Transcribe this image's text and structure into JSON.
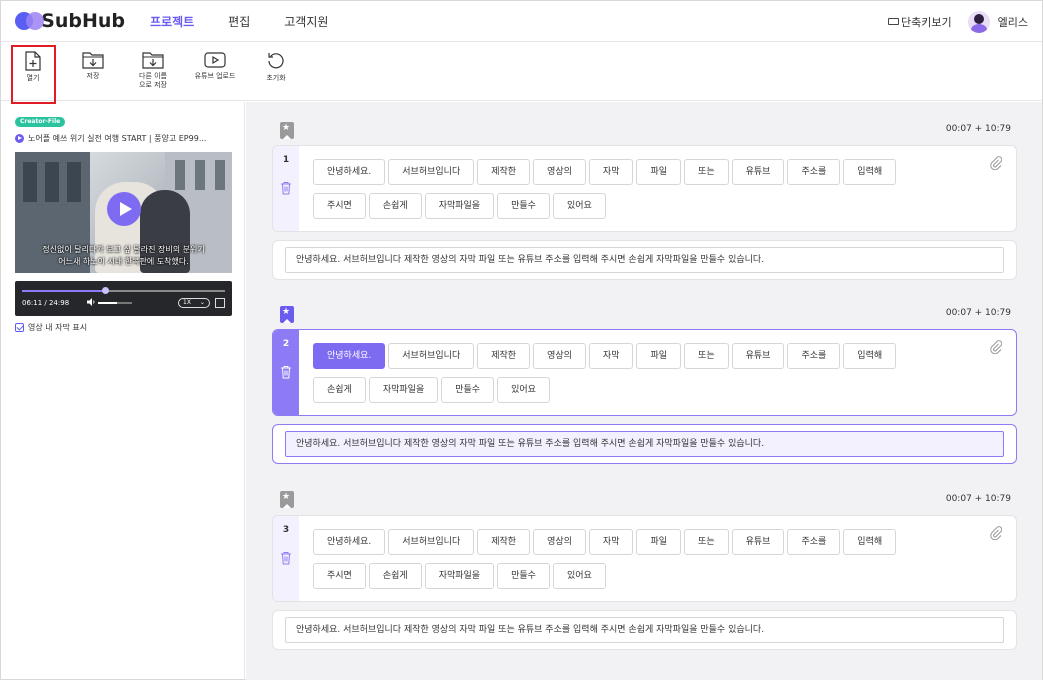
{
  "app": {
    "logo": "SubHub"
  },
  "nav": {
    "items": [
      {
        "label": "프로젝트",
        "active": true
      },
      {
        "label": "편집",
        "active": false
      },
      {
        "label": "고객지원",
        "active": false
      }
    ]
  },
  "header": {
    "shortcut": "단축키보기",
    "user": "엘리스"
  },
  "toolbar": {
    "open": "열기",
    "save": "저장",
    "save_as_1": "다른 이름",
    "save_as_2": "으로 저장",
    "youtube": "유튜브 업로드",
    "reset": "초기화"
  },
  "video": {
    "badge": "Creator-File",
    "title": "노어플 예쓰 위기 실전 여행 START | 풍양고 EP99...",
    "subtitle_1": "정신없이 달리다가 보고 싶 달라진 장비의 분위기",
    "subtitle_2": "어느새 하노이 시내 한복판에 도착했다.",
    "time": "06:11 / 24:98",
    "progress": 0.41,
    "volume": 0.55,
    "speed": "1X",
    "show_subs_label": "영상 내 자막 표시"
  },
  "segments": [
    {
      "number": "1",
      "time": "00:07 + 10:79",
      "active": false,
      "selected_chip": -1,
      "chips": [
        "안녕하세요.",
        "서브허브입니다",
        "제작한",
        "영상의",
        "자막",
        "파일",
        "또는",
        "유튜브",
        "주소를",
        "입력해",
        "주시면",
        "손쉽게",
        "자막파일을",
        "만들수",
        "있어요"
      ],
      "text": "안녕하세요. 서브허브입니다 제작한 영상의 자막 파일 또는 유튜브 주소를 입력해 주시면 손쉽게 자막파일을 만들수 있습니다."
    },
    {
      "number": "2",
      "time": "00:07 + 10:79",
      "active": true,
      "selected_chip": 0,
      "chips": [
        "안녕하세요.",
        "서브허브입니다",
        "제작한",
        "영상의",
        "자막",
        "파일",
        "또는",
        "유튜브",
        "주소를",
        "입력해",
        "손쉽게",
        "자막파일을",
        "만들수",
        "있어요"
      ],
      "text": "안녕하세요. 서브허브입니다 제작한 영상의 자막 파일 또는 유튜브 주소를 입력해 주시면 손쉽게 자막파일을 만들수 있습니다."
    },
    {
      "number": "3",
      "time": "00:07 + 10:79",
      "active": false,
      "selected_chip": -1,
      "chips": [
        "안녕하세요.",
        "서브허브입니다",
        "제작한",
        "영상의",
        "자막",
        "파일",
        "또는",
        "유튜브",
        "주소를",
        "입력해",
        "주시면",
        "손쉽게",
        "자막파일을",
        "만들수",
        "있어요"
      ],
      "text": "안녕하세요. 서브허브입니다 제작한 영상의 자막 파일 또는 유튜브 주소를 입력해 주시면 손쉽게 자막파일을 만들수 있습니다."
    }
  ],
  "colors": {
    "accent": "#6b5cf0",
    "chip_selected": "#7d6cf2",
    "highlight": "#e01d25",
    "badge": "#2bc29f"
  },
  "icons": [
    "logo-icon",
    "keyboard-icon",
    "avatar",
    "file-add-icon",
    "folder-download-icon",
    "folder-save-as-icon",
    "youtube-upload-icon",
    "reset-icon",
    "play-icon",
    "volume-icon",
    "fullscreen-icon",
    "bookmark-icon",
    "trash-icon",
    "paperclip-icon"
  ]
}
